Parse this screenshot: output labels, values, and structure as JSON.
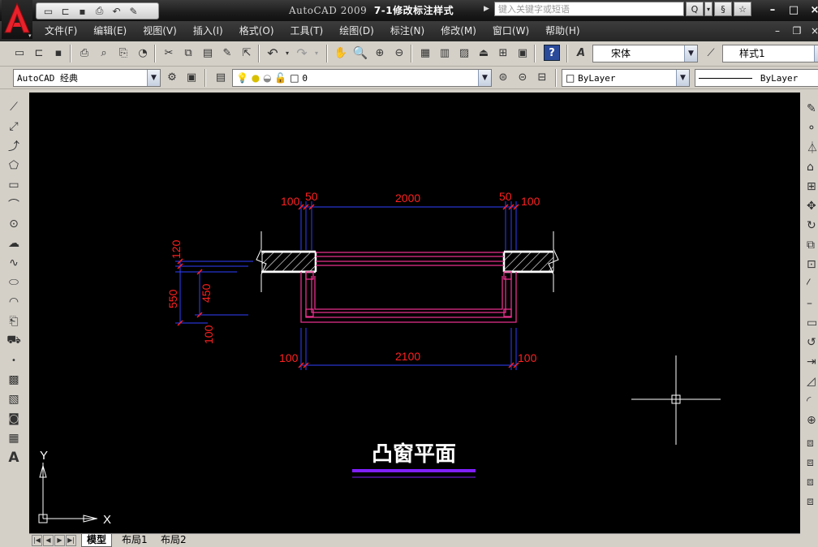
{
  "window": {
    "app_name": "AutoCAD 2009",
    "document_title": "7-1修改标注样式",
    "search_placeholder": "键入关键字或短语",
    "search_tools": [
      "Q",
      "§",
      "☆"
    ],
    "controls": {
      "minimize": "–",
      "maximize": "□",
      "close": "×"
    },
    "mdi_controls": {
      "minimize": "–",
      "restore": "❐",
      "close": "×"
    }
  },
  "menu": {
    "items": [
      "文件(F)",
      "编辑(E)",
      "视图(V)",
      "插入(I)",
      "格式(O)",
      "工具(T)",
      "绘图(D)",
      "标注(N)",
      "修改(M)",
      "窗口(W)",
      "帮助(H)"
    ]
  },
  "toolbars": {
    "text_font": "宋体",
    "dim_style": "样式1",
    "workspace": "AutoCAD 经典",
    "layer_name": "0",
    "color": "ByLayer",
    "linetype": "ByLayer"
  },
  "drawing": {
    "title": "凸窗平面",
    "dimensions": {
      "top": [
        "100",
        "50",
        "2000",
        "50",
        "100"
      ],
      "bottom": [
        "100",
        "2100",
        "100"
      ],
      "left": [
        "120",
        "550",
        "450",
        "100"
      ]
    },
    "ucs": {
      "x_label": "X",
      "y_label": "Y"
    },
    "colors": {
      "background": "#000000",
      "dimension_text": "#ff2020",
      "dimension_line": "#3040ff",
      "window": "#e8308c",
      "wall": "#ffffff",
      "title_underline": "#8020ff"
    }
  },
  "layout_tabs": {
    "nav": [
      "|◀",
      "◀",
      "▶",
      "▶|"
    ],
    "tabs": [
      "模型",
      "布局1",
      "布局2"
    ],
    "active": "模型"
  }
}
